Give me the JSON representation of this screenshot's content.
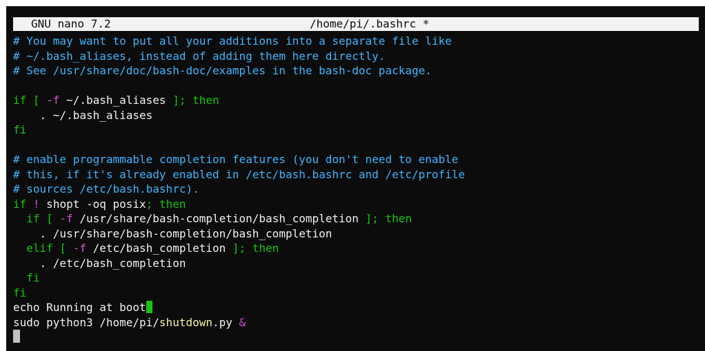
{
  "title_bar": {
    "app": "GNU nano 7.2",
    "file": "/home/pi/.bashrc *"
  },
  "lines": [
    {
      "segments": [
        {
          "text": "# You may want to put all your additions into a separate file like",
          "role": "comment"
        }
      ]
    },
    {
      "segments": [
        {
          "text": "# ~/.bash_aliases, instead of adding them here directly.",
          "role": "comment"
        }
      ]
    },
    {
      "segments": [
        {
          "text": "# See /usr/share/doc/bash-doc/examples in the bash-doc package.",
          "role": "comment"
        }
      ]
    },
    {
      "segments": []
    },
    {
      "segments": [
        {
          "text": "if [ ",
          "role": "keyword"
        },
        {
          "text": "-f",
          "role": "operator"
        },
        {
          "text": " ~/.bash_aliases ",
          "role": "text"
        },
        {
          "text": "]; then",
          "role": "keyword"
        }
      ]
    },
    {
      "segments": [
        {
          "text": "    . ~/.bash_aliases",
          "role": "text"
        }
      ]
    },
    {
      "segments": [
        {
          "text": "fi",
          "role": "keyword"
        }
      ]
    },
    {
      "segments": []
    },
    {
      "segments": [
        {
          "text": "# enable programmable completion features (you don't need to enable",
          "role": "comment"
        }
      ]
    },
    {
      "segments": [
        {
          "text": "# this, if it's already enabled in /etc/bash.bashrc and /etc/profile",
          "role": "comment"
        }
      ]
    },
    {
      "segments": [
        {
          "text": "# sources /etc/bash.bashrc).",
          "role": "comment"
        }
      ]
    },
    {
      "segments": [
        {
          "text": "if ",
          "role": "keyword"
        },
        {
          "text": "!",
          "role": "operator"
        },
        {
          "text": " shopt -oq posix",
          "role": "text"
        },
        {
          "text": "; then",
          "role": "keyword"
        }
      ]
    },
    {
      "segments": [
        {
          "text": "  if [ ",
          "role": "keyword"
        },
        {
          "text": "-f",
          "role": "operator"
        },
        {
          "text": " /usr/share/bash-completion/bash_completion ",
          "role": "text"
        },
        {
          "text": "]; then",
          "role": "keyword"
        }
      ]
    },
    {
      "segments": [
        {
          "text": "    . /usr/share/bash-completion/bash_completion",
          "role": "text"
        }
      ]
    },
    {
      "segments": [
        {
          "text": "  elif [ ",
          "role": "keyword"
        },
        {
          "text": "-f",
          "role": "operator"
        },
        {
          "text": " /etc/bash_completion ",
          "role": "text"
        },
        {
          "text": "]; then",
          "role": "keyword"
        }
      ]
    },
    {
      "segments": [
        {
          "text": "    . /etc/bash_completion",
          "role": "text"
        }
      ]
    },
    {
      "segments": [
        {
          "text": "  fi",
          "role": "keyword"
        }
      ]
    },
    {
      "segments": [
        {
          "text": "fi",
          "role": "keyword"
        }
      ]
    },
    {
      "segments": [
        {
          "text": "echo Running at boot",
          "role": "text"
        }
      ],
      "cursor": "highlight"
    },
    {
      "segments": [
        {
          "text": "sudo python3 /home/pi/",
          "role": "text"
        },
        {
          "text": "shutdown",
          "role": "yellow"
        },
        {
          "text": ".py ",
          "role": "text"
        },
        {
          "text": "&",
          "role": "operator"
        }
      ]
    },
    {
      "segments": [],
      "cursor": "main"
    }
  ],
  "colors": {
    "background": "#0c0c0c",
    "title_bar_bg": "#f2f2f2",
    "comment": "#40b4ff",
    "keyword": "#16c60c",
    "operator": "#d14fd6",
    "text": "#f2f2f2",
    "yellow": "#f9f1a5",
    "cursor_highlight": "#16c60c",
    "cursor_main": "#c0c0c0"
  }
}
